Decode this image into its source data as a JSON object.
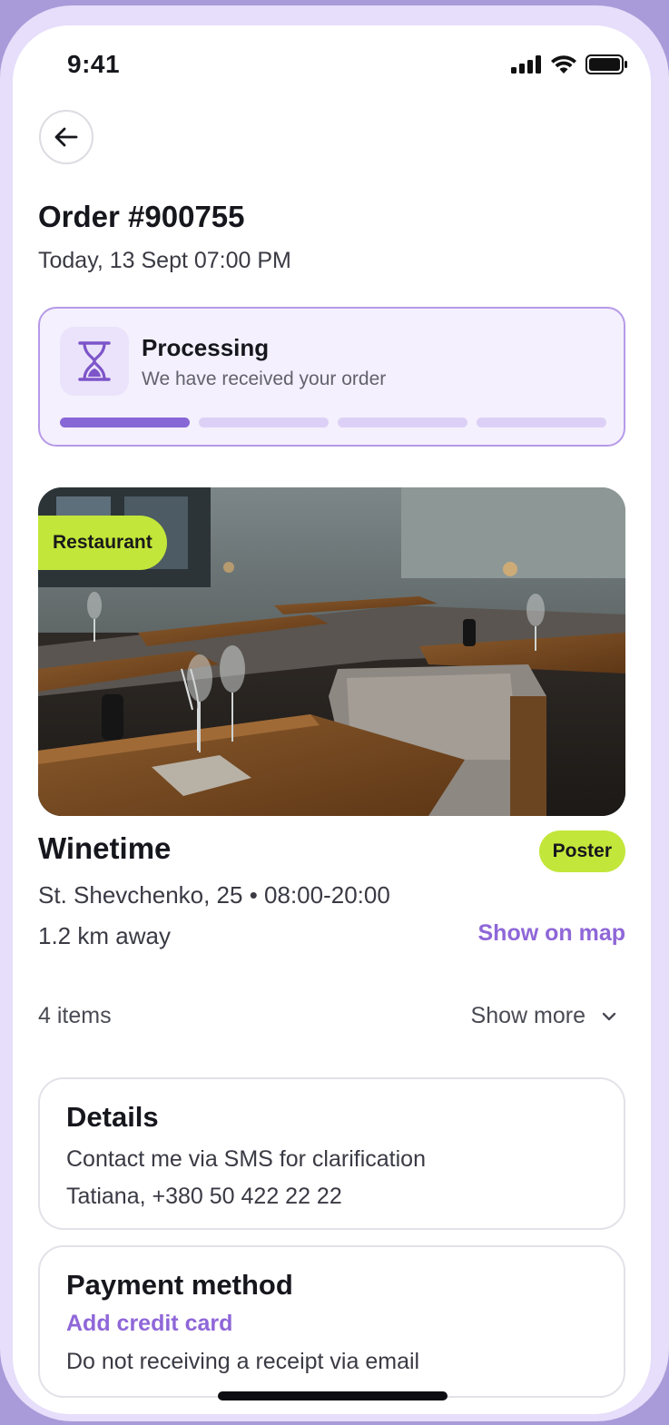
{
  "status_bar": {
    "time": "9:41"
  },
  "order": {
    "title": "Order #900755",
    "date": "Today, 13 Sept 07:00 PM"
  },
  "status": {
    "title": "Processing",
    "subtitle": "We have received your order",
    "progress_steps_total": 4,
    "progress_steps_done": 1,
    "icon": "hourglass-icon"
  },
  "place": {
    "category_tag": "Restaurant",
    "name": "Winetime",
    "badge": "Poster",
    "address": "St. Shevchenko, 25 • 08:00-20:00",
    "distance": "1.2 km away",
    "map_link": "Show on map"
  },
  "items": {
    "count_label": "4 items",
    "show_more_label": "Show more"
  },
  "details": {
    "title": "Details",
    "line1": "Contact me via SMS for clarification",
    "line2": "Tatiana, +380 50 422 22 22"
  },
  "payment": {
    "title": "Payment method",
    "add_card": "Add credit card",
    "receipt_note": "Do not receiving a receipt via email"
  },
  "colors": {
    "accent": "#8f67d8",
    "progress_active": "#8766d6",
    "tag_green": "#c3e63a",
    "frame": "#a99ad9"
  }
}
